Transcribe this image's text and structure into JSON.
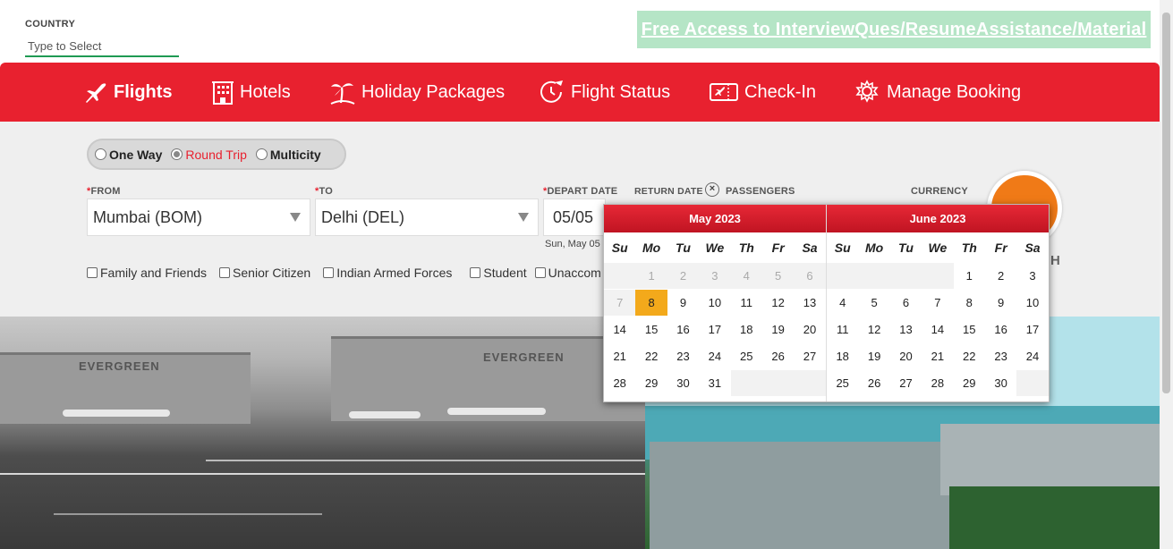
{
  "top": {
    "country_label": "COUNTRY",
    "country_placeholder": "Type to Select",
    "promo_link": "Free Access to InterviewQues/ResumeAssistance/Material"
  },
  "nav": {
    "flights": "Flights",
    "hotels": "Hotels",
    "holiday": "Holiday Packages",
    "flight_status": "Flight Status",
    "checkin": "Check-In",
    "manage": "Manage Booking"
  },
  "trip": {
    "one_way": "One Way",
    "round_trip": "Round Trip",
    "multicity": "Multicity",
    "selected": "Round Trip"
  },
  "fields": {
    "from_label": "FROM",
    "from_value": "Mumbai (BOM)",
    "to_label": "TO",
    "to_value": "Delhi (DEL)",
    "depart_label": "DEPART DATE",
    "depart_value": "05/05",
    "depart_sub": "Sun, May 05",
    "return_label": "RETURN DATE",
    "passengers_label": "PASSENGERS",
    "currency_label": "CURRENCY",
    "search_letter": "H"
  },
  "checks": [
    "Family and Friends",
    "Senior Citizen",
    "Indian Armed Forces",
    "Student",
    "Unaccom"
  ],
  "calendar": {
    "dow": [
      "Su",
      "Mo",
      "Tu",
      "We",
      "Th",
      "Fr",
      "Sa"
    ],
    "months": [
      {
        "title": "May 2023",
        "weeks": [
          [
            "",
            "1",
            "2",
            "3",
            "4",
            "5",
            "6"
          ],
          [
            "7",
            "8",
            "9",
            "10",
            "11",
            "12",
            "13"
          ],
          [
            "14",
            "15",
            "16",
            "17",
            "18",
            "19",
            "20"
          ],
          [
            "21",
            "22",
            "23",
            "24",
            "25",
            "26",
            "27"
          ],
          [
            "28",
            "29",
            "30",
            "31",
            "",
            "",
            ""
          ]
        ],
        "disabled_through": "7",
        "highlighted": "8"
      },
      {
        "title": "June 2023",
        "weeks": [
          [
            "",
            "",
            "",
            "",
            "1",
            "2",
            "3"
          ],
          [
            "4",
            "5",
            "6",
            "7",
            "8",
            "9",
            "10"
          ],
          [
            "11",
            "12",
            "13",
            "14",
            "15",
            "16",
            "17"
          ],
          [
            "18",
            "19",
            "20",
            "21",
            "22",
            "23",
            "24"
          ],
          [
            "25",
            "26",
            "27",
            "28",
            "29",
            "30",
            ""
          ]
        ],
        "disabled_through": "",
        "highlighted": ""
      }
    ]
  },
  "hero": {
    "hangar_text_1": "EVERGREEN",
    "hangar_text_2": "EVERGREEN"
  },
  "colors": {
    "brand_red": "#e8212f",
    "search_orange": "#f07a17",
    "today_highlight": "#f3a91b",
    "promo_green": "#b5e5c6"
  }
}
